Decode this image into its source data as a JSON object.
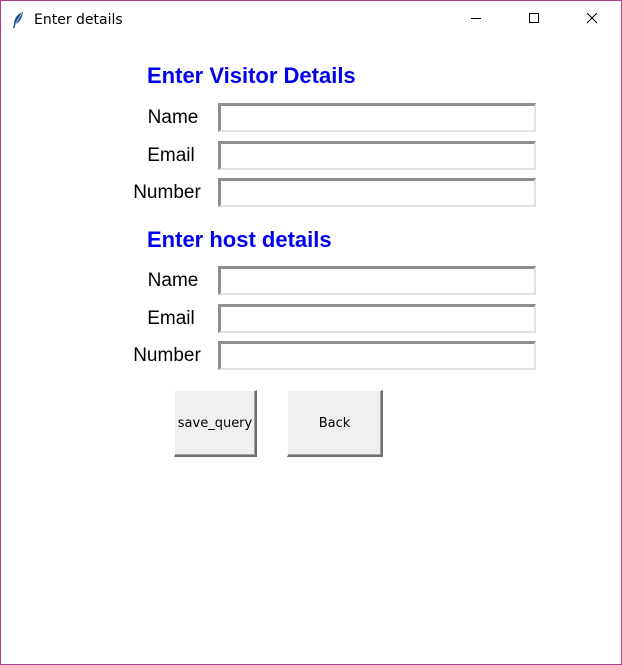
{
  "window": {
    "title": "Enter details"
  },
  "visitor": {
    "heading": "Enter Visitor Details",
    "fields": [
      {
        "label": "Name",
        "value": ""
      },
      {
        "label": "Email",
        "value": ""
      },
      {
        "label": "Number",
        "value": ""
      }
    ]
  },
  "host": {
    "heading": "Enter host details",
    "fields": [
      {
        "label": "Name",
        "value": ""
      },
      {
        "label": "Email",
        "value": ""
      },
      {
        "label": "Number",
        "value": ""
      }
    ]
  },
  "buttons": {
    "save_label": "save_query",
    "back_label": "Back"
  },
  "colors": {
    "heading": "#0000ee",
    "window_border": "#b43c8c",
    "button_face": "#f0f0f0"
  },
  "icons": [
    "feather-icon",
    "minimize-icon",
    "maximize-icon",
    "close-icon"
  ]
}
